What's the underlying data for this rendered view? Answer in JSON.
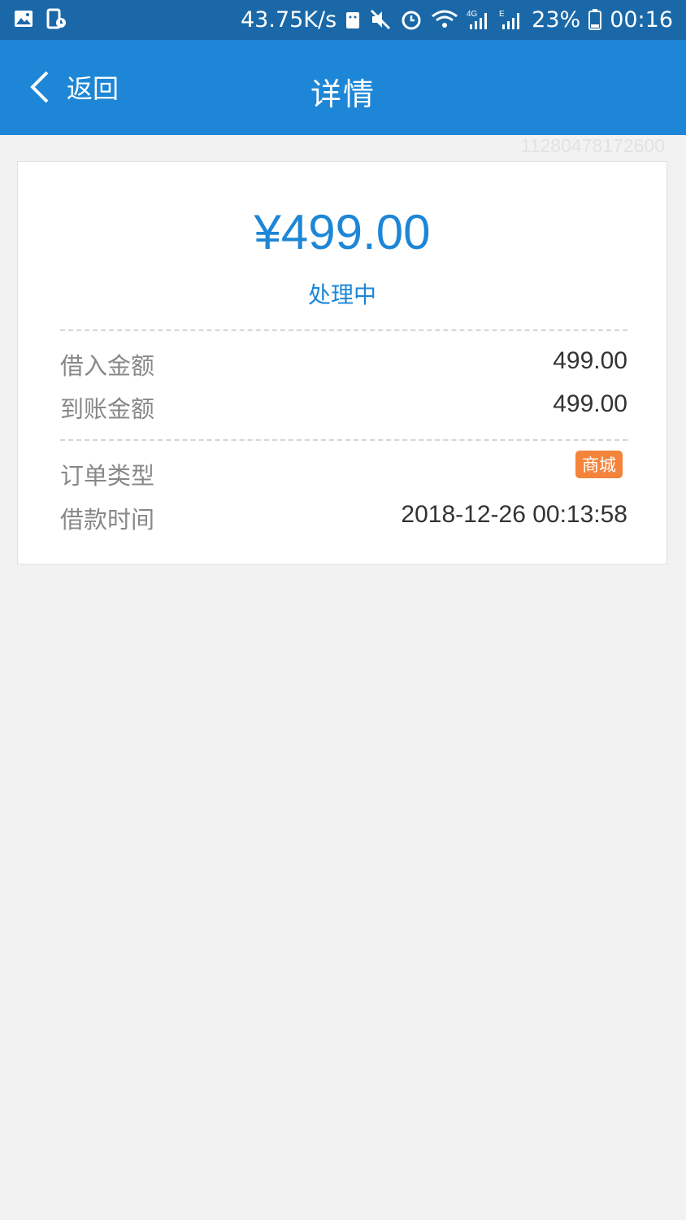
{
  "status_bar": {
    "speed": "43.75K/s",
    "battery": "23%",
    "time": "00:16",
    "icons": [
      "gallery-icon",
      "screen-record-icon",
      "android-icon",
      "mute-icon",
      "alarm-icon",
      "wifi-icon",
      "signal-4g-icon",
      "signal-e-icon",
      "battery-icon"
    ]
  },
  "header": {
    "back_label": "返回",
    "title": "详情"
  },
  "order_id": "11280478172600",
  "card": {
    "amount": "¥499.00",
    "status": "处理中",
    "rows_group1": [
      {
        "label": "借入金额",
        "value": "499.00"
      },
      {
        "label": "到账金额",
        "value": "499.00"
      }
    ],
    "order_type": {
      "label": "订单类型",
      "tag": "商城"
    },
    "loan_time": {
      "label": "借款时间",
      "value": "2018-12-26 00:13:58"
    }
  },
  "colors": {
    "status_bar": "#1a68a8",
    "header": "#1d86d6",
    "accent": "#1d86d6",
    "tag": "#f5843b",
    "background": "#f2f2f2"
  }
}
